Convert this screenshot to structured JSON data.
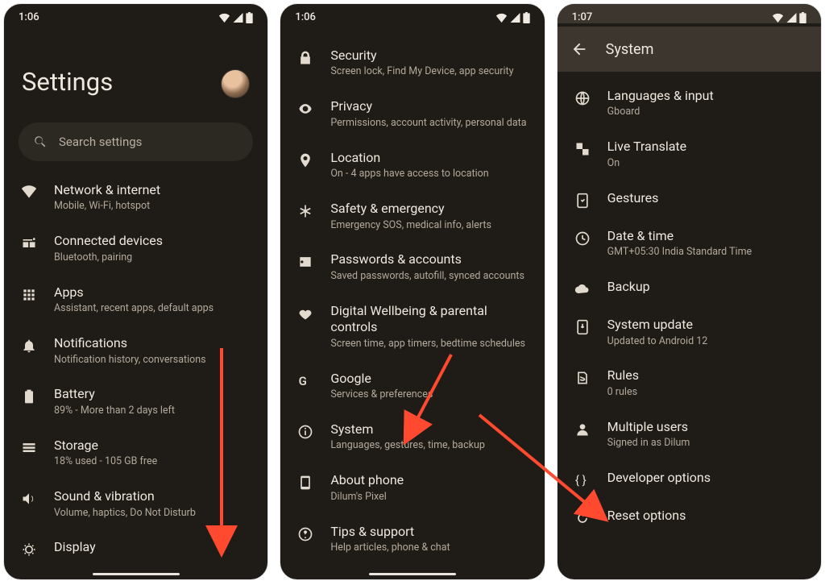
{
  "status": {
    "time_a": "1:06",
    "time_b": "1:06",
    "time_c": "1:07"
  },
  "screen1": {
    "title": "Settings",
    "search_placeholder": "Search settings",
    "items": [
      {
        "icon": "wifi",
        "title": "Network & internet",
        "sub": "Mobile, Wi-Fi, hotspot"
      },
      {
        "icon": "devices",
        "title": "Connected devices",
        "sub": "Bluetooth, pairing"
      },
      {
        "icon": "apps",
        "title": "Apps",
        "sub": "Assistant, recent apps, default apps"
      },
      {
        "icon": "bell",
        "title": "Notifications",
        "sub": "Notification history, conversations"
      },
      {
        "icon": "battery",
        "title": "Battery",
        "sub": "89% - More than 2 days left"
      },
      {
        "icon": "storage",
        "title": "Storage",
        "sub": "18% used - 105 GB free"
      },
      {
        "icon": "sound",
        "title": "Sound & vibration",
        "sub": "Volume, haptics, Do Not Disturb"
      },
      {
        "icon": "display",
        "title": "Display",
        "sub": ""
      }
    ]
  },
  "screen2": {
    "items": [
      {
        "icon": "lock",
        "title": "Security",
        "sub": "Screen lock, Find My Device, app security"
      },
      {
        "icon": "privacy",
        "title": "Privacy",
        "sub": "Permissions, account activity, personal data"
      },
      {
        "icon": "location",
        "title": "Location",
        "sub": "On - 4 apps have access to location"
      },
      {
        "icon": "asterisk",
        "title": "Safety & emergency",
        "sub": "Emergency SOS, medical info, alerts"
      },
      {
        "icon": "key",
        "title": "Passwords & accounts",
        "sub": "Saved passwords, autofill, synced accounts"
      },
      {
        "icon": "wellbeing",
        "title": "Digital Wellbeing & parental controls",
        "sub": "Screen time, app timers, bedtime schedules"
      },
      {
        "icon": "google",
        "title": "Google",
        "sub": "Services & preferences"
      },
      {
        "icon": "info",
        "title": "System",
        "sub": "Languages, gestures, time, backup"
      },
      {
        "icon": "phone",
        "title": "About phone",
        "sub": "Dilum's Pixel"
      },
      {
        "icon": "tips",
        "title": "Tips & support",
        "sub": "Help articles, phone & chat"
      }
    ]
  },
  "screen3": {
    "appbar_title": "System",
    "items": [
      {
        "icon": "globe",
        "title": "Languages & input",
        "sub": "Gboard"
      },
      {
        "icon": "translate",
        "title": "Live Translate",
        "sub": "On"
      },
      {
        "icon": "gestures",
        "title": "Gestures",
        "sub": ""
      },
      {
        "icon": "clock",
        "title": "Date & time",
        "sub": "GMT+05:30 India Standard Time"
      },
      {
        "icon": "cloud",
        "title": "Backup",
        "sub": ""
      },
      {
        "icon": "update",
        "title": "System update",
        "sub": "Updated to Android 12"
      },
      {
        "icon": "rules",
        "title": "Rules",
        "sub": "0 rules"
      },
      {
        "icon": "users",
        "title": "Multiple users",
        "sub": "Signed in as Dilum"
      },
      {
        "icon": "braces",
        "title": "Developer options",
        "sub": ""
      },
      {
        "icon": "reset",
        "title": "Reset options",
        "sub": ""
      }
    ]
  }
}
